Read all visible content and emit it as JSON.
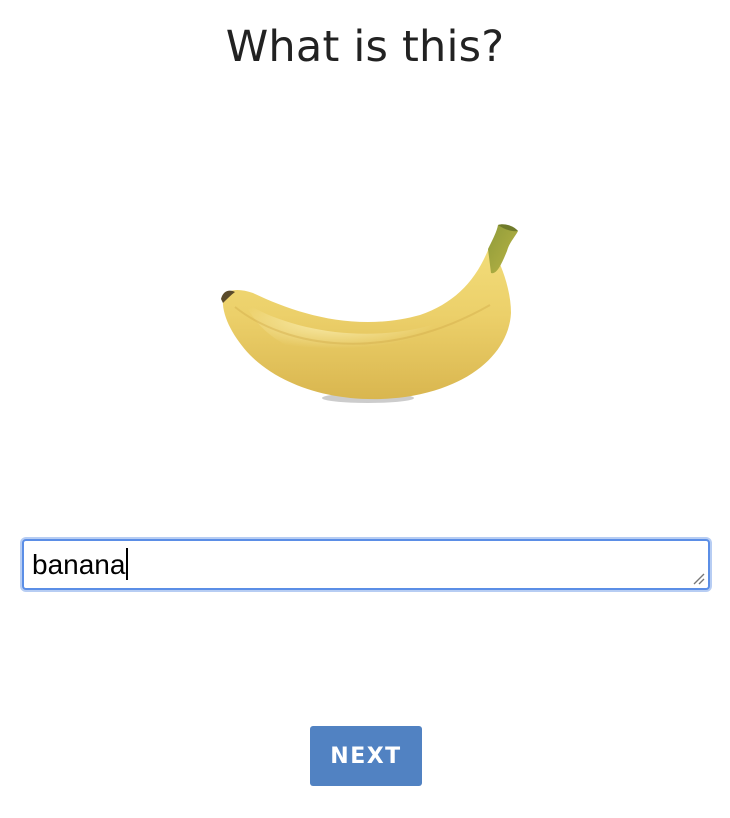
{
  "question": {
    "title": "What is this?"
  },
  "image": {
    "subject_icon": "banana-image"
  },
  "answer": {
    "value": "banana"
  },
  "actions": {
    "next_label": "NEXT"
  },
  "colors": {
    "accent": "#5182c2",
    "focus_border": "#5b8ee6",
    "text": "#222222"
  }
}
